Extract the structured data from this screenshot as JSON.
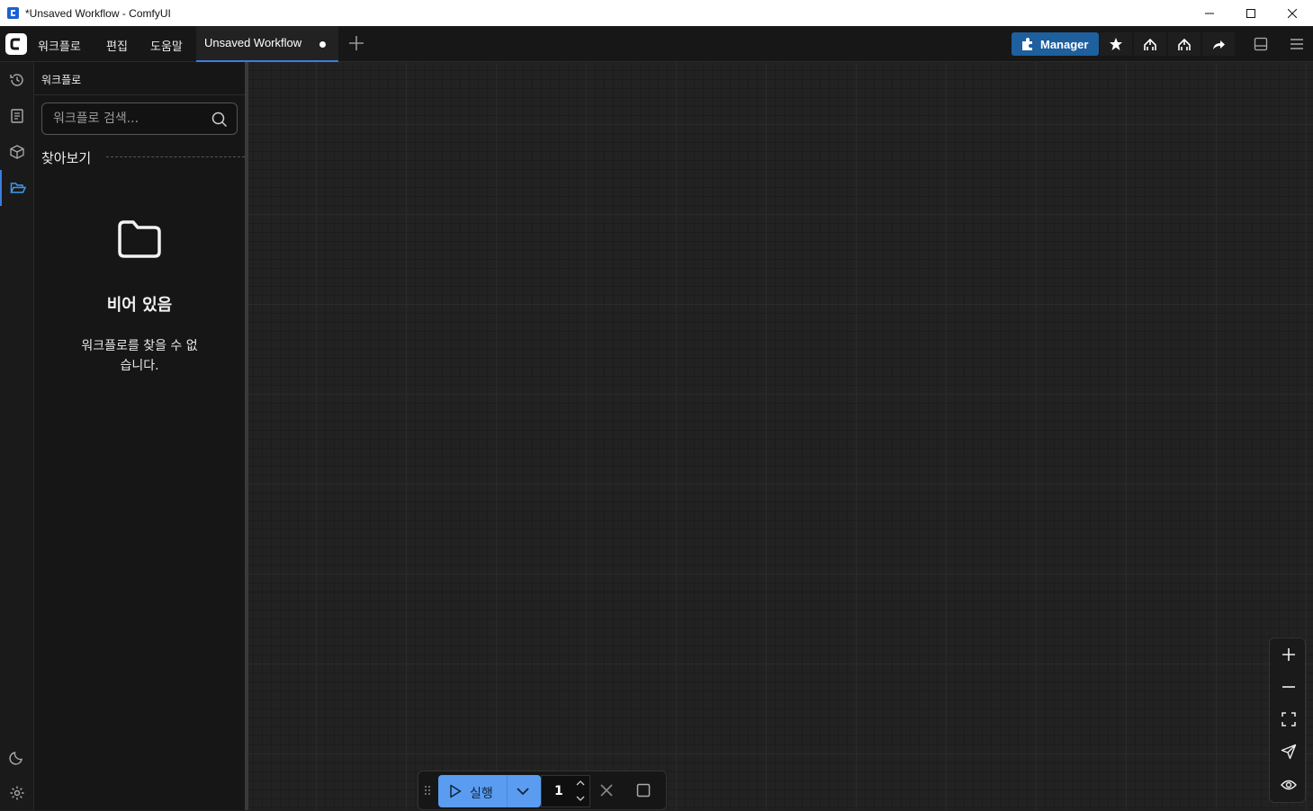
{
  "window": {
    "title": "*Unsaved Workflow - ComfyUI"
  },
  "menu": {
    "workflow": "워크플로",
    "edit": "편집",
    "help": "도움말"
  },
  "tab": {
    "label": "Unsaved Workflow"
  },
  "toolbar": {
    "manager_label": "Manager"
  },
  "panel": {
    "title": "워크플로",
    "search_placeholder": "워크플로 검색...",
    "browse_label": "찾아보기",
    "empty_title": "비어 있음",
    "empty_message": "워크플로를 찾을 수 없습니다."
  },
  "run_bar": {
    "run_label": "실행",
    "batch_count": "1"
  },
  "colors": {
    "accent": "#3b7de0",
    "run_button": "#5a9cf0",
    "manager_button": "#1e5f9e"
  }
}
